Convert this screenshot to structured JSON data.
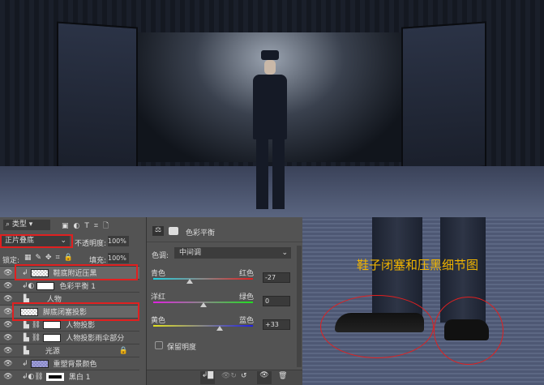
{
  "layers_panel": {
    "filter_kind": "类型",
    "blend_mode": "正片叠底",
    "opacity_label": "不透明度:",
    "opacity_value": "100%",
    "lock_label": "锁定:",
    "fill_label": "填充:",
    "fill_value": "100%",
    "layers": [
      {
        "name": "鞋底附近压黑",
        "type": "clipped",
        "highlighted": true
      },
      {
        "name": "色彩平衡 1",
        "type": "adjustment"
      },
      {
        "name": "人物",
        "type": "group"
      },
      {
        "name": "脚底闭塞投影",
        "type": "pixel",
        "highlighted": true
      },
      {
        "name": "人物投影",
        "type": "group-mask"
      },
      {
        "name": "人物投影雨伞部分",
        "type": "group-mask"
      },
      {
        "name": "光源",
        "type": "group",
        "locked": true
      },
      {
        "name": "重塑背景颜色",
        "type": "clipped"
      },
      {
        "name": "黑白 1",
        "type": "adjustment"
      }
    ]
  },
  "properties_panel": {
    "title": "色彩平衡",
    "tone_label": "色调:",
    "tone_value": "中间调",
    "sliders": [
      {
        "left": "青色",
        "right": "红色",
        "value": "-27",
        "num": -27,
        "colors": [
          "#20d0e0",
          "#e02020"
        ]
      },
      {
        "left": "洋红",
        "right": "绿色",
        "value": "0",
        "num": 0,
        "colors": [
          "#e020e0",
          "#20e020"
        ]
      },
      {
        "left": "黄色",
        "right": "蓝色",
        "value": "+33",
        "num": 33,
        "colors": [
          "#e0e020",
          "#2020e0"
        ]
      }
    ],
    "preserve_luminosity": "保留明度"
  },
  "detail_view": {
    "caption": "鞋子闭塞和压黑细节图",
    "caption_color": "#f0b400",
    "marker_color": "#e02020"
  }
}
